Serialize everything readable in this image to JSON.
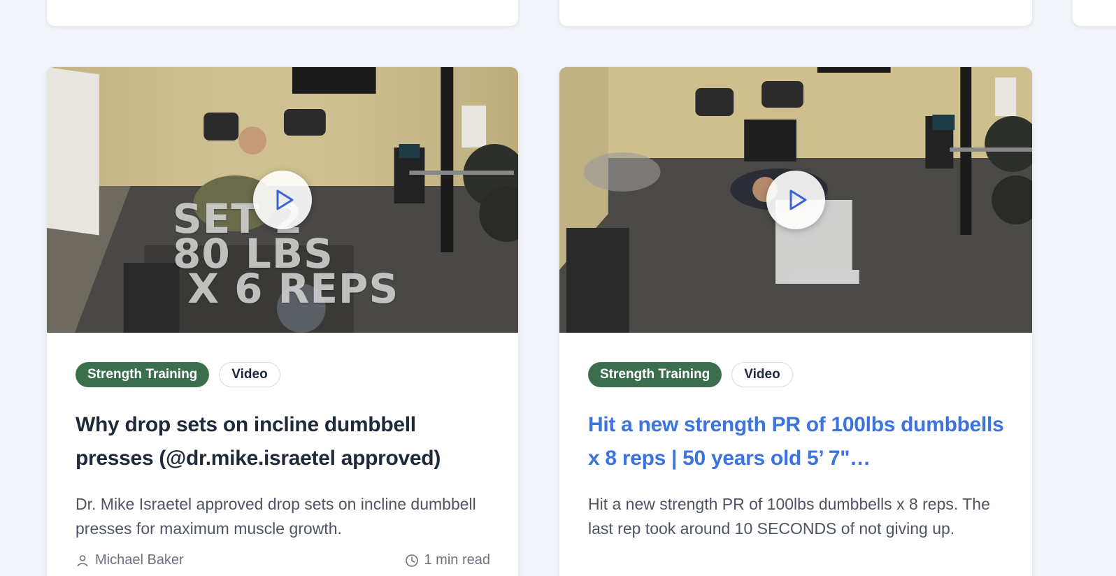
{
  "cards": [
    {
      "tags": {
        "category": "Strength Training",
        "type": "Video"
      },
      "overlay_text": "SET 2\n80 LBS\n X 6 REPS",
      "title": "Why drop sets on incline dumbbell presses (@dr.mike.israetel approved)",
      "description": "Dr. Mike Israetel approved drop sets on incline dumbbell presses for maximum muscle growth.",
      "author": "Michael Baker",
      "read_time": "1 min read"
    },
    {
      "tags": {
        "category": "Strength Training",
        "type": "Video"
      },
      "title": "Hit a new strength PR of 100lbs dumbbells x 8 reps | 50 years old 5’ 7\"…",
      "description": "Hit a new strength PR of 100lbs dumbbells x 8 reps. The last rep took around 10 SECONDS of not giving up."
    }
  ],
  "icons": {
    "play": "play-icon",
    "author": "user-icon",
    "time": "clock-icon"
  },
  "colors": {
    "tag_primary": "#3b6e4d",
    "title_link": "#3b73e0",
    "play_icon": "#3b63d6"
  }
}
